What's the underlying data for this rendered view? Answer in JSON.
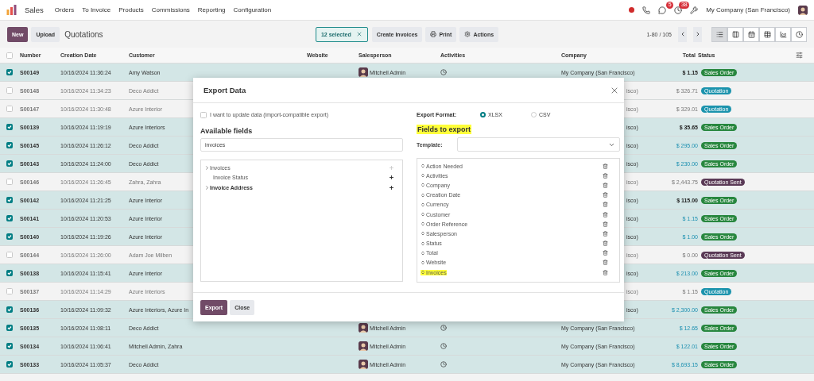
{
  "navbar": {
    "app": "Sales",
    "menu": [
      "Orders",
      "To Invoice",
      "Products",
      "Commissions",
      "Reporting",
      "Configuration"
    ],
    "systray": [
      {
        "kind": "dot"
      },
      {
        "kind": "phone"
      },
      {
        "kind": "chat",
        "badge": "5"
      },
      {
        "kind": "clock",
        "badge": "38"
      },
      {
        "kind": "tools"
      }
    ],
    "company": "My Company (San Francisco)"
  },
  "control_bar": {
    "new_button": "New",
    "upload_button": "Upload",
    "title": "Quotations",
    "selection": "12 selected",
    "actions": [
      {
        "label": "Create Invoices",
        "kind": "plain"
      },
      {
        "label": "Print",
        "kind": "print"
      },
      {
        "label": "Actions",
        "kind": "gear"
      }
    ],
    "pager": "1-80 / 105",
    "views": [
      {
        "kind": "list",
        "selected": true
      },
      {
        "kind": "kanban",
        "selected": false
      },
      {
        "kind": "calendar",
        "selected": false
      },
      {
        "kind": "pivot",
        "selected": false
      },
      {
        "kind": "graph",
        "selected": false
      },
      {
        "kind": "activity",
        "selected": false
      }
    ]
  },
  "table": {
    "select_all": {
      "checked": false
    },
    "columns": [
      "Number",
      "Creation Date",
      "Customer",
      "Website",
      "Salesperson",
      "Activities",
      "Company",
      "Total",
      "Status"
    ],
    "rows": [
      {
        "selected": true,
        "number": "S00149",
        "date": "10/16/2024 11:36:24",
        "customer": "Amy Watson",
        "salesperson": "Mitchell Admin",
        "company": "My Company (San Francisco)",
        "total": {
          "text": "$ 1.15",
          "kind": "bold"
        },
        "status": {
          "label": "Sales Order",
          "color": "#28873f"
        }
      },
      {
        "selected": false,
        "number": "S00148",
        "date": "10/16/2024 11:34:23",
        "customer": "Deco Addict",
        "company": "isco)",
        "total": {
          "text": "$ 326.71",
          "kind": "plain"
        },
        "status": {
          "label": "Quotation",
          "color": "#1b93ad"
        }
      },
      {
        "selected": false,
        "number": "S00147",
        "date": "10/16/2024 11:30:48",
        "customer": "Azure Interior",
        "company": "isco)",
        "total": {
          "text": "$ 329.01",
          "kind": "plain"
        },
        "status": {
          "label": "Quotation",
          "color": "#1b93ad"
        }
      },
      {
        "selected": true,
        "number": "S00139",
        "date": "10/16/2024 11:19:19",
        "customer": "Azure Interiors",
        "company": "isco)",
        "total": {
          "text": "$ 35.65",
          "kind": "bold"
        },
        "status": {
          "label": "Sales Order",
          "color": "#28873f"
        }
      },
      {
        "selected": true,
        "number": "S00145",
        "date": "10/16/2024 11:26:12",
        "customer": "Deco Addict",
        "company": "isco)",
        "total": {
          "text": "$ 295.00",
          "kind": "link"
        },
        "status": {
          "label": "Sales Order",
          "color": "#28873f"
        }
      },
      {
        "selected": true,
        "number": "S00143",
        "date": "10/16/2024 11:24:00",
        "customer": "Deco Addict",
        "company": "isco)",
        "total": {
          "text": "$ 230.00",
          "kind": "link"
        },
        "status": {
          "label": "Sales Order",
          "color": "#28873f"
        }
      },
      {
        "selected": false,
        "number": "S00146",
        "date": "10/16/2024 11:26:45",
        "customer": "Zahra, Zahra",
        "company": "isco)",
        "total": {
          "text": "$ 2,443.75",
          "kind": "plain"
        },
        "status": {
          "label": "Quotation Sent",
          "color": "#5a3a56"
        }
      },
      {
        "selected": true,
        "number": "S00142",
        "date": "10/16/2024 11:21:25",
        "customer": "Azure Interior",
        "company": "isco)",
        "total": {
          "text": "$ 115.00",
          "kind": "bold"
        },
        "status": {
          "label": "Sales Order",
          "color": "#28873f"
        }
      },
      {
        "selected": true,
        "number": "S00141",
        "date": "10/16/2024 11:20:53",
        "customer": "Azure Interior",
        "company": "isco)",
        "total": {
          "text": "$ 1.15",
          "kind": "link"
        },
        "status": {
          "label": "Sales Order",
          "color": "#28873f"
        }
      },
      {
        "selected": true,
        "number": "S00140",
        "date": "10/16/2024 11:19:26",
        "customer": "Azure Interior",
        "company": "isco)",
        "total": {
          "text": "$ 1.00",
          "kind": "link"
        },
        "status": {
          "label": "Sales Order",
          "color": "#28873f"
        }
      },
      {
        "selected": false,
        "number": "S00144",
        "date": "10/16/2024 11:26:00",
        "customer": "Adam Joe Milben",
        "company": "isco)",
        "total": {
          "text": "$ 0.00",
          "kind": "plain"
        },
        "status": {
          "label": "Quotation Sent",
          "color": "#5a3a56"
        }
      },
      {
        "selected": true,
        "number": "S00138",
        "date": "10/16/2024 11:15:41",
        "customer": "Azure Interior",
        "company": "isco)",
        "total": {
          "text": "$ 213.00",
          "kind": "link"
        },
        "status": {
          "label": "Sales Order",
          "color": "#28873f"
        }
      },
      {
        "selected": false,
        "number": "S00137",
        "date": "10/16/2024 11:14:29",
        "customer": "Azure Interiors",
        "company": "isco)",
        "total": {
          "text": "$ 1.15",
          "kind": "plain"
        },
        "status": {
          "label": "Quotation",
          "color": "#1b93ad"
        }
      },
      {
        "selected": true,
        "number": "S00136",
        "date": "10/16/2024 11:09:32",
        "customer": "Azure Interiors, Azure In",
        "company": "isco)",
        "total": {
          "text": "$ 2,300.00",
          "kind": "link"
        },
        "status": {
          "label": "Sales Order",
          "color": "#28873f"
        }
      },
      {
        "selected": true,
        "number": "S00135",
        "date": "10/16/2024 11:08:11",
        "customer": "Deco Addict",
        "salesperson": "Mitchell Admin",
        "company": "My Company (San Francisco)",
        "total": {
          "text": "$ 12.65",
          "kind": "link"
        },
        "status": {
          "label": "Sales Order",
          "color": "#28873f"
        }
      },
      {
        "selected": true,
        "number": "S00134",
        "date": "10/16/2024 11:06:41",
        "customer": "Mitchell Admin, Zahra",
        "salesperson": "Mitchell Admin",
        "company": "My Company (San Francisco)",
        "total": {
          "text": "$ 122.01",
          "kind": "link"
        },
        "status": {
          "label": "Sales Order",
          "color": "#28873f"
        }
      },
      {
        "selected": true,
        "number": "S00133",
        "date": "10/16/2024 11:05:37",
        "customer": "Deco Addict",
        "salesperson": "Mitchell Admin",
        "company": "My Company (San Francisco)",
        "total": {
          "text": "$ 8,693.15",
          "kind": "link"
        },
        "status": {
          "label": "Sales Order",
          "color": "#28873f"
        }
      }
    ]
  },
  "dialog": {
    "title": "Export Data",
    "import_compatible": {
      "label": "I want to update data (import-compatible export)",
      "checked": false
    },
    "available_heading": "Available fields",
    "search": {
      "value": "invoices"
    },
    "available": [
      {
        "label": "Invoices",
        "kind": "group",
        "required": false,
        "disabled": true
      },
      {
        "label": "Invoice Status",
        "kind": "field",
        "required": false,
        "disabled": false
      },
      {
        "label": "Invoice Address",
        "kind": "group",
        "required": true,
        "disabled": false
      }
    ],
    "format_label": "Export Format:",
    "formats": [
      {
        "label": "XLSX",
        "selected": true
      },
      {
        "label": "CSV",
        "selected": false
      }
    ],
    "fields_heading": {
      "text": "Fields to export",
      "highlighted": true
    },
    "template_label": "Template:",
    "fields": [
      {
        "label": "Action Needed",
        "highlighted": false
      },
      {
        "label": "Activities",
        "highlighted": false
      },
      {
        "label": "Company",
        "highlighted": false
      },
      {
        "label": "Creation Date",
        "highlighted": false
      },
      {
        "label": "Currency",
        "highlighted": false
      },
      {
        "label": "Customer",
        "highlighted": false
      },
      {
        "label": "Order Reference",
        "highlighted": false
      },
      {
        "label": "Salesperson",
        "highlighted": false
      },
      {
        "label": "Status",
        "highlighted": false
      },
      {
        "label": "Total",
        "highlighted": false
      },
      {
        "label": "Website",
        "highlighted": false
      },
      {
        "label": "Invoices",
        "highlighted": true
      }
    ],
    "buttons": [
      {
        "label": "Export",
        "kind": "primary"
      },
      {
        "label": "Close",
        "kind": "secondary"
      }
    ]
  }
}
